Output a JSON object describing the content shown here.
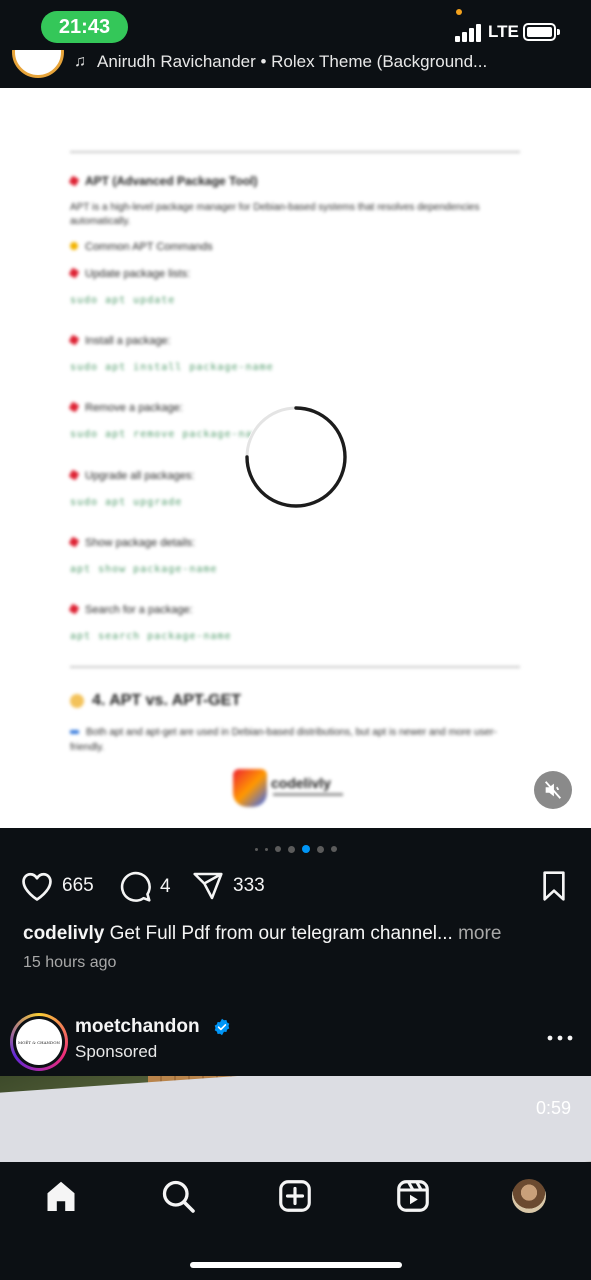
{
  "status_bar": {
    "time": "21:43",
    "network": "LTE"
  },
  "prev_post": {
    "audio": "Anirudh Ravichander • Rolex Theme (Background..."
  },
  "document": {
    "heading1": "APT (Advanced Package Tool)",
    "desc": "APT is a high-level package manager for Debian-based systems that resolves dependencies automatically.",
    "common_title": "Common APT Commands",
    "commands": [
      {
        "label": "Update package lists:",
        "code": "sudo apt update"
      },
      {
        "label": "Install a package:",
        "code": "sudo apt install package-name"
      },
      {
        "label": "Remove a package:",
        "code": "sudo apt remove package-name"
      },
      {
        "label": "Upgrade all packages:",
        "code": "sudo apt upgrade"
      },
      {
        "label": "Show package details:",
        "code": "apt show package-name"
      },
      {
        "label": "Search for a package:",
        "code": "apt search package-name"
      }
    ],
    "section2": "4. APT vs. APT-GET",
    "section2_note": "Both apt and apt-get are used in Debian-based distributions, but apt is newer and more user-friendly.",
    "brand": "codelivly"
  },
  "post": {
    "likes": "665",
    "comments": "4",
    "shares": "333",
    "username": "codelivly",
    "caption": "Get Full Pdf from our telegram channel...",
    "more": "more",
    "time_ago": "15 hours ago",
    "carousel_total": 7,
    "carousel_active": 4
  },
  "next_post": {
    "username": "moetchandon",
    "subtitle": "Sponsored",
    "avatar_text": "MOËT & CHANDON",
    "duration": "0:59"
  },
  "colors": {
    "background": "#0c1014",
    "time_pill": "#34c759",
    "verified": "#0095f6",
    "active_dot": "#0095f6"
  },
  "icons": [
    "heart-icon",
    "comment-icon",
    "share-icon",
    "bookmark-icon",
    "mute-icon",
    "home-icon",
    "search-icon",
    "create-icon",
    "reels-icon",
    "more-icon",
    "verified-icon"
  ]
}
